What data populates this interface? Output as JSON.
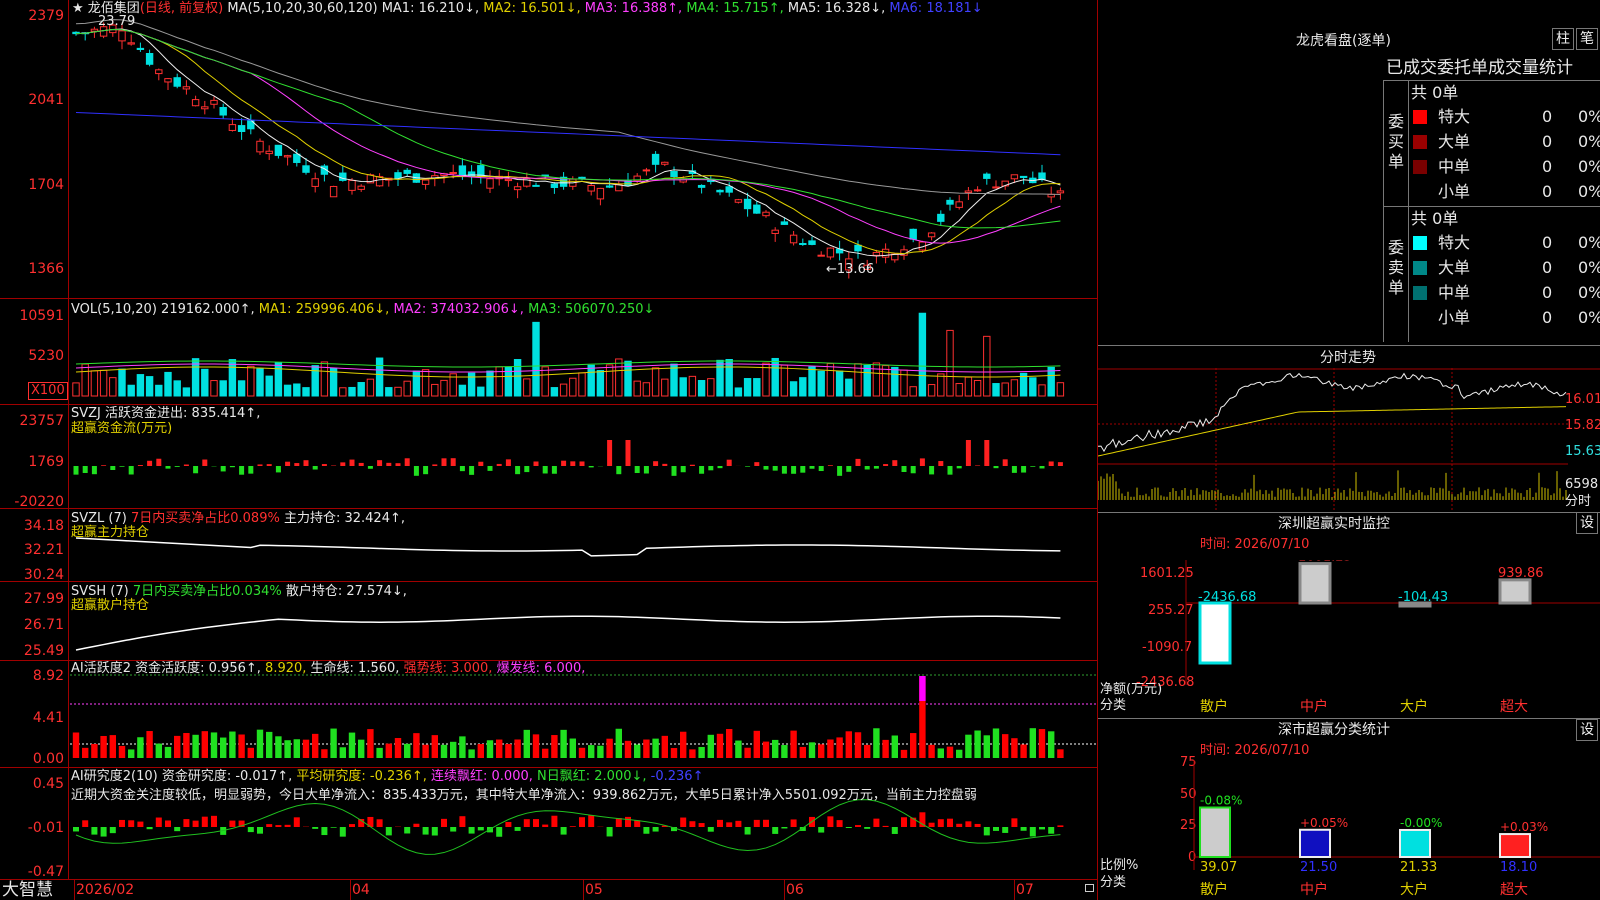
{
  "header": {
    "star": "★",
    "stock_name": "龙佰集团",
    "period": "(日线, 前复权)",
    "ma_legend": "MA(5,10,20,30,60,120)",
    "ma1": "MA1: 16.210↓,",
    "ma2": "MA2: 16.501↓,",
    "ma3": "MA3: 16.388↑,",
    "ma4": "MA4: 15.715↑,",
    "ma5": "MA5: 16.328↓,",
    "ma6": "MA6: 18.181↓",
    "high_label": "23.79",
    "low_label": "←13.66"
  },
  "price_axis": [
    "2379",
    "2041",
    "1704",
    "1366"
  ],
  "vol": {
    "legend": "VOL(5,10,20)",
    "value": "219162.000↑,",
    "ma1": "MA1: 259996.406↓,",
    "ma2": "MA2: 374032.906↓,",
    "ma3": "MA3: 506070.250↓",
    "axis": [
      "10591",
      "5230"
    ],
    "unit_btn": "X100"
  },
  "svzj": {
    "legend": "SVZJ",
    "title": "活跃资金进出: 835.414↑,",
    "subtitle": "超赢资金流(万元)",
    "axis": [
      "23757",
      "1769",
      "-20220"
    ]
  },
  "svzl": {
    "legend": "SVZL (7)",
    "ratio": "7日内买卖净占比0.089%",
    "hold": "主力持仓: 32.424↑,",
    "subtitle": "超赢主力持仓",
    "axis": [
      "34.18",
      "32.21",
      "30.24"
    ]
  },
  "svsh": {
    "legend": "SVSH (7)",
    "ratio": "7日内买卖净占比0.034%",
    "hold": "散户持仓: 27.574↓,",
    "subtitle": "超赢散户持仓",
    "axis": [
      "27.99",
      "26.71",
      "25.49"
    ]
  },
  "ai1": {
    "legend": "AI活跃度2",
    "act": "资金活跃度: 0.956↑,",
    "v2": "8.920,",
    "life": "生命线: 1.560,",
    "strong": "强势线: 3.000,",
    "burst": "爆发线: 6.000,",
    "axis": [
      "8.92",
      "4.41",
      "0.00"
    ]
  },
  "ai2": {
    "legend": "AI研究度2(10)",
    "research": "资金研究度: -0.017↑,",
    "avg": "平均研究度: -0.236↑,",
    "cont": "连续飘红: 0.000,",
    "nday": "N日飘红: 2.000↓,",
    "v5": "-0.236↑",
    "comment": "近期大资金关注度较低，明显弱势，今日大单净流入：835.433万元，其中特大单净流入：939.862万元，大单5日累计净入5501.092万元，当前主力控盘弱",
    "axis": [
      "0.45",
      "-0.01",
      "-0.47"
    ]
  },
  "bottom": {
    "brand": "大智慧",
    "dates": [
      "2026/02",
      "04",
      "05",
      "06",
      "07"
    ]
  },
  "right": {
    "lhb_title": "龙虎看盘(逐单)",
    "btn_bar": "柱",
    "btn_pen": "笔",
    "stats_title": "已成交委托单成交量统计",
    "buy_label": "委买单",
    "sell_label": "委卖单",
    "buy_total": "共 0单",
    "sell_total": "共 0单",
    "rows": [
      {
        "name": "特大",
        "count": "0",
        "pct": "0%"
      },
      {
        "name": "大单",
        "count": "0",
        "pct": "0%"
      },
      {
        "name": "中单",
        "count": "0",
        "pct": "0%"
      },
      {
        "name": "小单",
        "count": "0",
        "pct": "0%"
      }
    ],
    "intraday_title": "分时走势",
    "intraday_axis": [
      "16.01",
      "15.82",
      "15.63",
      "6598",
      "分时"
    ],
    "monitor_title": "深圳超赢实时监控",
    "monitor_time": "时间: 2026/07/10",
    "monitor_axis": [
      "1601.25",
      "255.27",
      "-1090.7",
      "-2436.68"
    ],
    "monitor_values": [
      "-2436.68",
      "1601.25",
      "-104.43",
      "939.86"
    ],
    "monitor_unit": "净额(万元)",
    "cat_label": "分类",
    "categories": [
      "散户",
      "中户",
      "大户",
      "超大"
    ],
    "class_title": "深市超赢分类统计",
    "class_time": "时间: 2026/07/10",
    "class_axis": [
      "75",
      "50",
      "25",
      "0"
    ],
    "class_changes": [
      "-0.08%",
      "+0.05%",
      "-0.00%",
      "+0.03%"
    ],
    "class_values": [
      "39.07",
      "21.50",
      "21.33",
      "18.10"
    ],
    "ratio_label": "比例%",
    "set_btn": "设"
  },
  "chart_data": [
    {
      "type": "candlestick",
      "title": "龙佰集团 (日线, 前复权)",
      "ylim": [
        13.66,
        23.79
      ],
      "high": 23.79,
      "low": 13.66,
      "ma": {
        "MA1": 16.21,
        "MA2": 16.501,
        "MA3": 16.388,
        "MA4": 15.715,
        "MA5": 16.328,
        "MA6": 18.181
      }
    },
    {
      "type": "bar",
      "title": "VOL(5,10,20)",
      "last": 219162.0,
      "ma": [
        259996.406,
        374032.906,
        506070.25
      ]
    },
    {
      "type": "bar",
      "title": "深圳超赢实时监控",
      "categories": [
        "散户",
        "中户",
        "大户",
        "超大"
      ],
      "values": [
        -2436.68,
        1601.25,
        -104.43,
        939.86
      ]
    },
    {
      "type": "bar",
      "title": "深市超赢分类统计",
      "categories": [
        "散户",
        "中户",
        "大户",
        "超大"
      ],
      "values": [
        39.07,
        21.5,
        21.33,
        18.1
      ],
      "changes": [
        "-0.08%",
        "+0.05%",
        "-0.00%",
        "+0.03%"
      ]
    }
  ],
  "colors": {
    "up": "#ff3030",
    "down": "#00e0e0",
    "grid": "#a00000",
    "flow_down": "#20e020"
  }
}
